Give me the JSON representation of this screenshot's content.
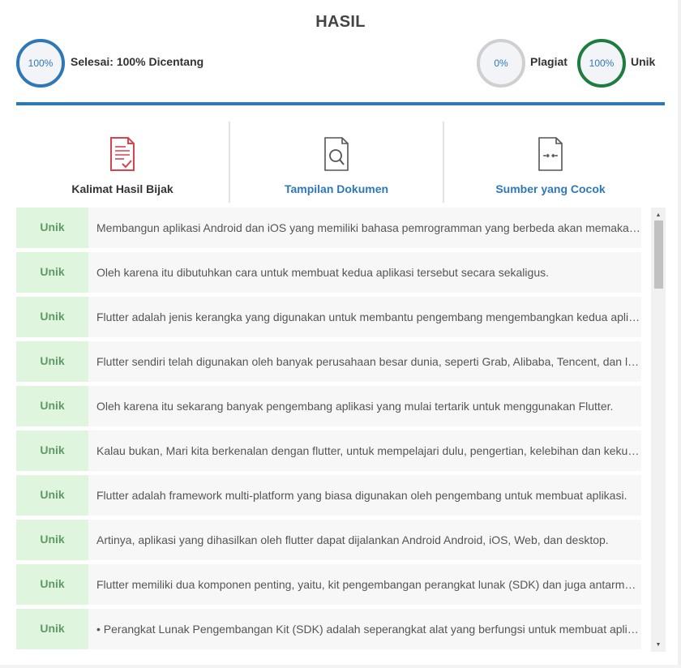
{
  "header": {
    "title": "HASIL"
  },
  "stats": {
    "done": {
      "percent": "100%",
      "label": "Selesai: 100% Dicentang"
    },
    "plagiat": {
      "percent": "0%",
      "label": "Plagiat"
    },
    "unik": {
      "percent": "100%",
      "label": "Unik"
    }
  },
  "colors": {
    "accent": "#2f78b7",
    "unique_ring": "#1e7d3e",
    "plagiat_ring": "#cfcfcf",
    "badge_bg": "#dff5dd",
    "badge_text": "#5e9a66",
    "tab_icon_active": "#d9434f"
  },
  "tabs": [
    {
      "label": "Kalimat Hasil Bijak",
      "icon": "document-check-icon",
      "active": true
    },
    {
      "label": "Tampilan Dokumen",
      "icon": "document-search-icon",
      "active": false
    },
    {
      "label": "Sumber yang Cocok",
      "icon": "document-compare-icon",
      "active": false
    }
  ],
  "rows": [
    {
      "badge": "Unik",
      "text": "Membangun aplikasi Android dan iOS yang memiliki bahasa pemrogramman yang berbeda akan memakan waktu yang lama."
    },
    {
      "badge": "Unik",
      "text": "Oleh karena itu dibutuhkan cara untuk membuat kedua aplikasi tersebut secara sekaligus."
    },
    {
      "badge": "Unik",
      "text": "Flutter adalah jenis kerangka yang digunakan untuk membantu pengembang mengembangkan kedua aplikasi."
    },
    {
      "badge": "Unik",
      "text": "Flutter sendiri telah digunakan oleh banyak perusahaan besar dunia, seperti Grab, Alibaba, Tencent, dan lainnya."
    },
    {
      "badge": "Unik",
      "text": "Oleh karena itu sekarang banyak pengembang aplikasi yang mulai tertarik untuk menggunakan Flutter."
    },
    {
      "badge": "Unik",
      "text": "Kalau bukan, Mari kita berkenalan dengan flutter, untuk mempelajari dulu, pengertian, kelebihan dan kekurangannya."
    },
    {
      "badge": "Unik",
      "text": "Flutter adalah framework multi-platform yang biasa digunakan oleh pengembang untuk membuat aplikasi."
    },
    {
      "badge": "Unik",
      "text": "Artinya, aplikasi yang dihasilkan oleh flutter dapat dijalankan Android Android, iOS, Web, dan desktop."
    },
    {
      "badge": "Unik",
      "text": "Flutter memiliki dua komponen penting, yaitu, kit pengembangan perangkat lunak (SDK) dan juga antarmuka."
    },
    {
      "badge": "Unik",
      "text": "• Perangkat Lunak Pengembangan Kit (SDK) adalah seperangkat alat yang berfungsi untuk membuat aplikasi."
    }
  ],
  "scrollbar": {
    "up_icon": "scroll-up-arrow-icon",
    "down_icon": "scroll-down-arrow-icon",
    "position": 0.0
  }
}
